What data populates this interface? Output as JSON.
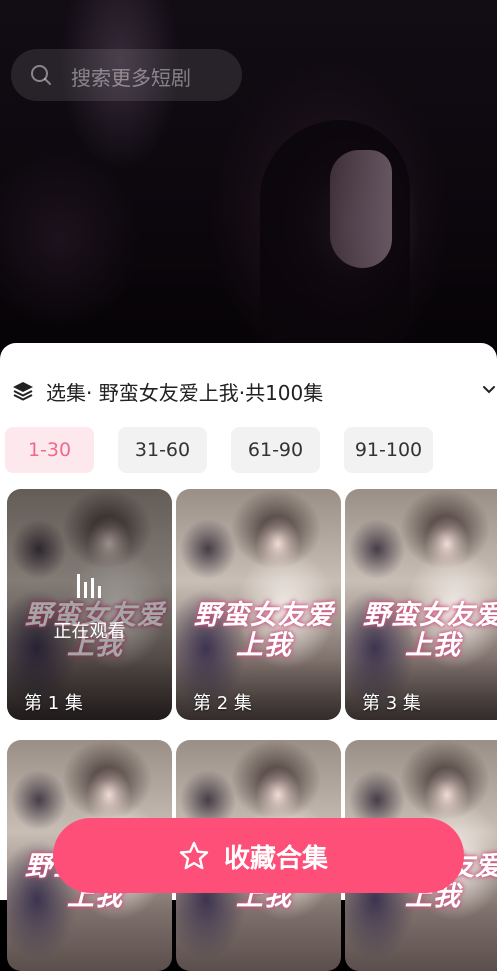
{
  "search": {
    "placeholder": "搜索更多短剧",
    "icon": "search-icon"
  },
  "sheet": {
    "title": "选集· 野蛮女友爱上我·共100集",
    "title_icon": "layers-icon",
    "collapse_icon": "chevron-down-icon"
  },
  "ranges": [
    {
      "label": "1-30",
      "active": true
    },
    {
      "label": "31-60",
      "active": false
    },
    {
      "label": "61-90",
      "active": false
    },
    {
      "label": "91-100",
      "active": false
    }
  ],
  "episodes": [
    {
      "label": "第 1 集",
      "status": "正在观看"
    },
    {
      "label": "第 2 集"
    },
    {
      "label": "第 3 集"
    }
  ],
  "poster_text": "野蛮女友爱上我",
  "favorite": {
    "label": "收藏合集",
    "icon": "star-icon"
  },
  "colors": {
    "accent": "#fe4f78",
    "active_tab_bg": "#fde8ee",
    "active_tab_text": "#ef6a8c"
  }
}
